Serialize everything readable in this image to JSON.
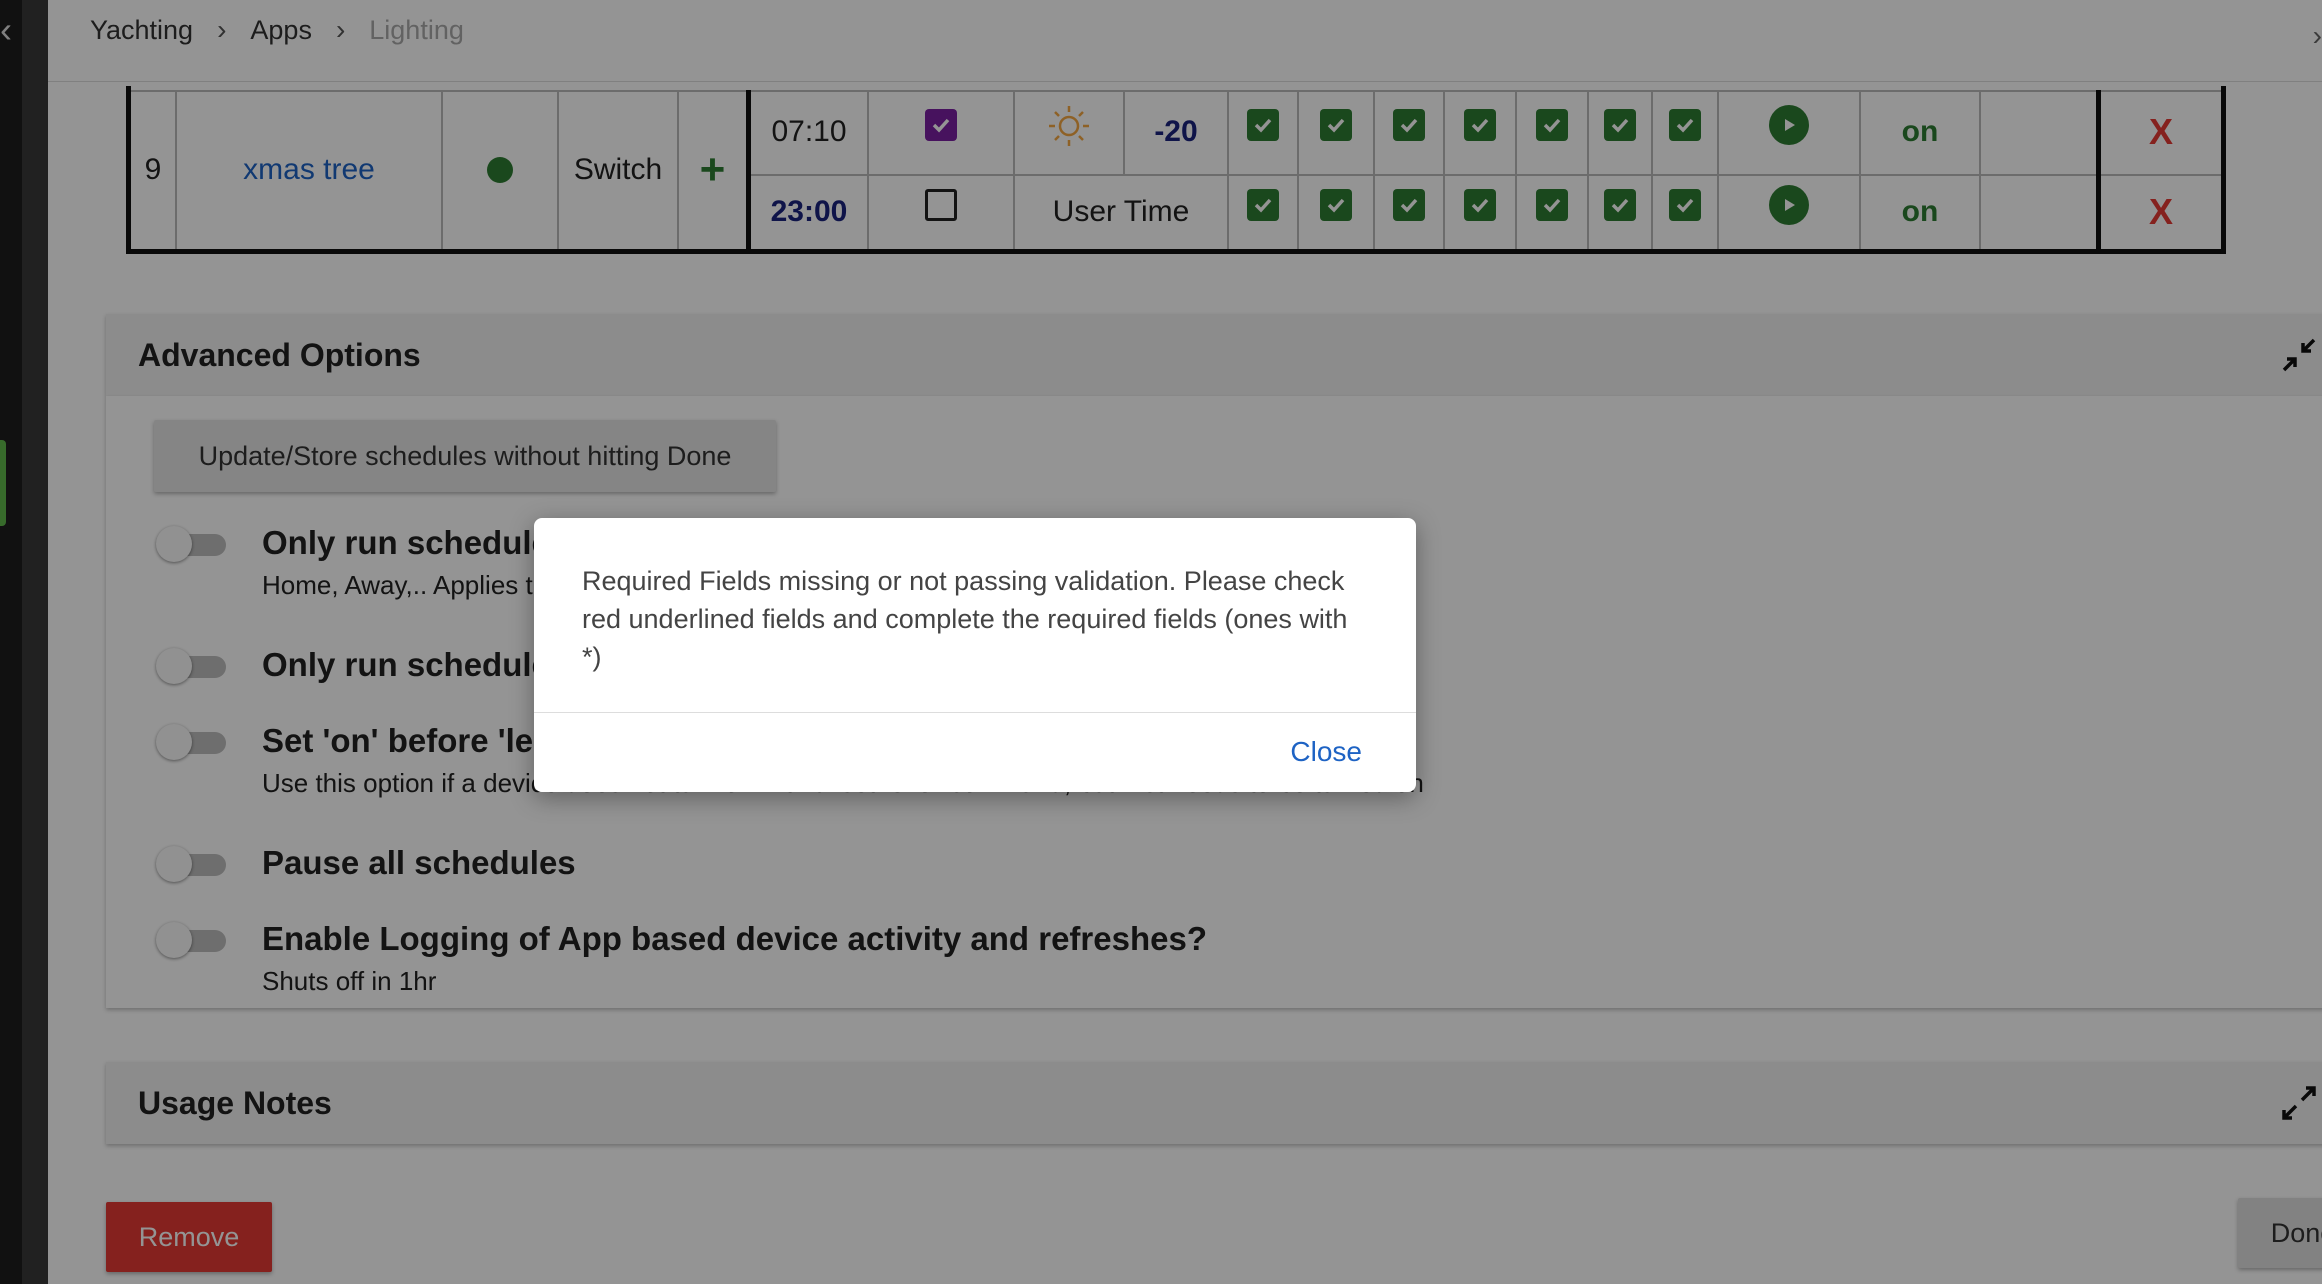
{
  "breadcrumb": [
    "Yachting",
    "Apps",
    "Lighting"
  ],
  "schedule": {
    "row_number": "9",
    "device_name": "xmas tree",
    "device_type": "Switch",
    "rows": [
      {
        "time": "07:10",
        "mode_value": "-20",
        "status": "on",
        "remove": "X"
      },
      {
        "time": "23:00",
        "mode_label": "User Time",
        "status": "on",
        "remove": "X"
      }
    ]
  },
  "advanced": {
    "title": "Advanced Options",
    "store_button": "Update/Store schedules without hitting Done",
    "options": [
      {
        "title": "Only run schedule",
        "desc": "Home, Away,.. Applies t"
      },
      {
        "title": "Only run schedule",
        "desc": ""
      },
      {
        "title": "Set 'on' before 'le",
        "desc": "Use this option if a device does not turn on with a 'setLevel' command, but first needs to be turned on"
      },
      {
        "title": "Pause all schedules",
        "desc": ""
      },
      {
        "title": "Enable Logging of App based device activity and refreshes?",
        "desc": "Shuts off in 1hr"
      }
    ]
  },
  "usage": {
    "title": "Usage Notes"
  },
  "buttons": {
    "remove": "Remove",
    "done": "Done"
  },
  "dialog": {
    "message": "Required Fields missing or not passing validation. Please check red underlined fields and complete the required fields (ones with *)",
    "close": "Close"
  },
  "colors": {
    "accent": "#1e63c4",
    "success": "#2e7d32",
    "danger": "#e53935",
    "checked_purple": "#7b1fa2"
  }
}
